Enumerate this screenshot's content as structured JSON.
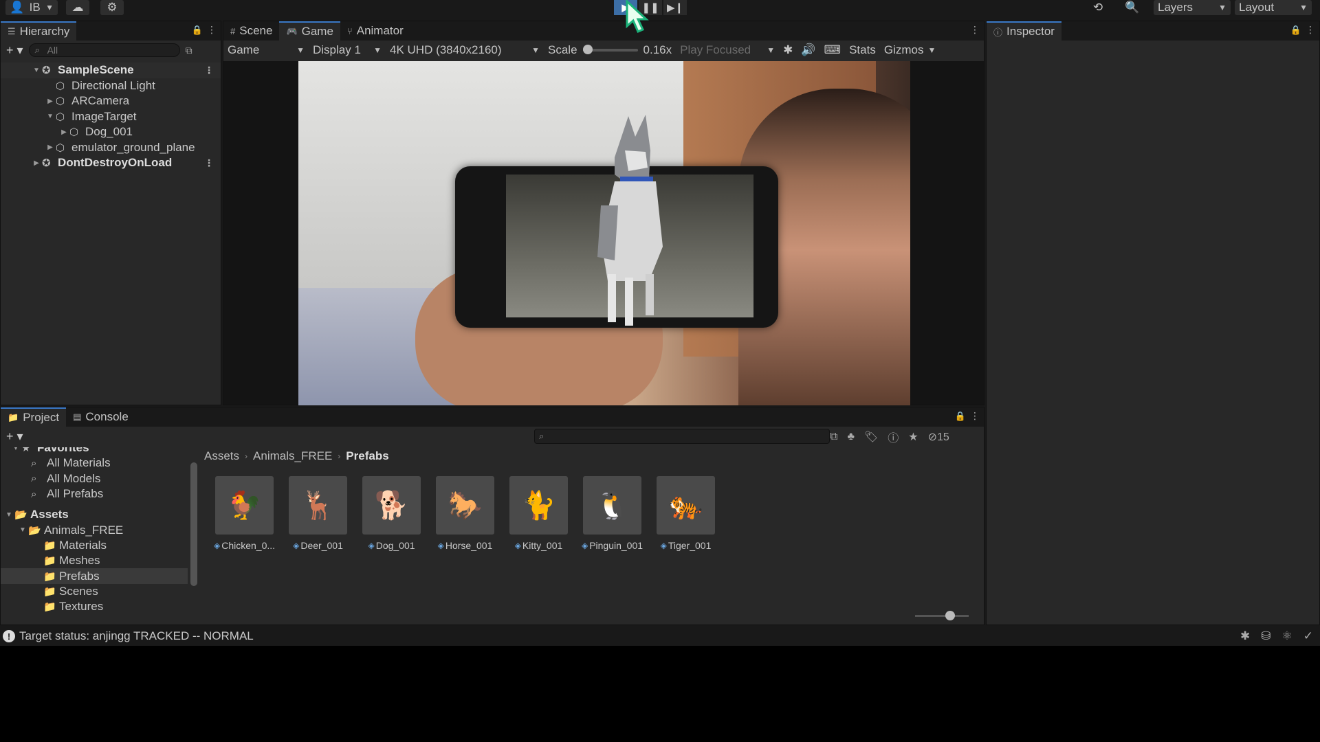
{
  "toolbar": {
    "account": "IB",
    "layers": "Layers",
    "layout": "Layout"
  },
  "hierarchy": {
    "tab": "Hierarchy",
    "search_placeholder": "All",
    "nodes": [
      {
        "label": "SampleScene"
      },
      {
        "label": "Directional Light"
      },
      {
        "label": "ARCamera"
      },
      {
        "label": "ImageTarget"
      },
      {
        "label": "Dog_001"
      },
      {
        "label": "emulator_ground_plane"
      },
      {
        "label": "DontDestroyOnLoad"
      }
    ]
  },
  "game": {
    "tabs": [
      "Scene",
      "Game",
      "Animator"
    ],
    "view": "Game",
    "display": "Display 1",
    "resolution": "4K UHD (3840x2160)",
    "scale_label": "Scale",
    "scale_value": "0.16x",
    "play_mode": "Play Focused",
    "stats": "Stats",
    "gizmos": "Gizmos"
  },
  "inspector": {
    "tab": "Inspector"
  },
  "project": {
    "tabs": [
      "Project",
      "Console"
    ],
    "hidden_count": "15",
    "tree": [
      {
        "label": "Favorites"
      },
      {
        "label": "All Materials"
      },
      {
        "label": "All Models"
      },
      {
        "label": "All Prefabs"
      },
      {
        "label": "Assets"
      },
      {
        "label": "Animals_FREE"
      },
      {
        "label": "Materials"
      },
      {
        "label": "Meshes"
      },
      {
        "label": "Prefabs"
      },
      {
        "label": "Scenes"
      },
      {
        "label": "Textures"
      }
    ],
    "breadcrumb": [
      "Assets",
      "Animals_FREE",
      "Prefabs"
    ],
    "assets": [
      {
        "name": "Chicken_0...",
        "icon": "🐓"
      },
      {
        "name": "Deer_001",
        "icon": "🦌"
      },
      {
        "name": "Dog_001",
        "icon": "🐕"
      },
      {
        "name": "Horse_001",
        "icon": "🐎"
      },
      {
        "name": "Kitty_001",
        "icon": "🐈"
      },
      {
        "name": "Pinguin_001",
        "icon": "🐧"
      },
      {
        "name": "Tiger_001",
        "icon": "🐅"
      }
    ]
  },
  "status": {
    "message": "Target status: anjingg TRACKED -- NORMAL"
  },
  "colors": {
    "accent": "#3a79c8",
    "play_active": "#3c6ea6",
    "panel": "#282828",
    "bar": "#191919"
  }
}
